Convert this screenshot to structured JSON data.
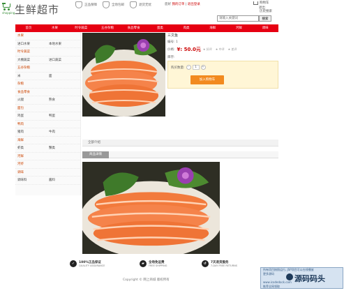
{
  "header": {
    "logo_cn": "生鲜超市",
    "logo_en": "shopping",
    "badges": [
      "正品保障",
      "全场包邮",
      "退货无忧"
    ],
    "welcome": "您好",
    "account_link": "我的订单",
    "separator": "|",
    "register": "退出登录",
    "cart": "购物车",
    "logout": "退出",
    "history": "历史搜索",
    "search_placeholder": "请输入关键词",
    "search_button": "搜索"
  },
  "nav": {
    "items": [
      "首页",
      "水果",
      "时令蔬菜",
      "五谷杂粮",
      "食品零食",
      "蛋类",
      "肉类",
      "海鲜",
      "河鲜",
      "调味"
    ]
  },
  "sidebar": {
    "rows": [
      [
        "水果",
        ""
      ],
      [
        "进口水果",
        "本地水果"
      ],
      [
        "时令蔬菜",
        ""
      ],
      [
        "大棚蔬菜",
        "进口蔬菜"
      ],
      [
        "五谷杂粮",
        ""
      ],
      [
        "米",
        "面"
      ],
      [
        "杂粮",
        ""
      ],
      [
        "食品零食",
        ""
      ],
      [
        "火腿",
        "熟食"
      ],
      [
        "面包",
        ""
      ],
      [
        "鸡蛋",
        "鸭蛋"
      ],
      [
        "鸭肉",
        ""
      ],
      [
        "猪肉",
        "牛肉"
      ],
      [
        "海鲜",
        ""
      ],
      [
        "虾类",
        "蟹类"
      ],
      [
        "河鲜",
        ""
      ],
      [
        "河虾",
        ""
      ],
      [
        "调味",
        ""
      ],
      [
        "调味料",
        "酱料"
      ]
    ]
  },
  "product": {
    "name": "三文鱼",
    "code_label": "编号:",
    "code_value": "1",
    "price_label": "价格:",
    "price": "¥: 50.0元",
    "stars": [
      "★ 好评",
      "★ 中评",
      "★ 差评"
    ],
    "stock_label": "库存:",
    "stock_value": "",
    "qty_label": "购买数量:",
    "qty_minus": "-",
    "qty_value": "1",
    "qty_plus": "+",
    "add_to_cart": "加入购物车"
  },
  "tabs": {
    "detail_bar": "全部介绍",
    "detail_tab": "商品详情"
  },
  "footer": {
    "guarantees": [
      {
        "icon": "quality-icon",
        "title": "100%正品保证",
        "sub": "QUALITY ASSURANCE"
      },
      {
        "icon": "shipping-icon",
        "title": "全场免运费",
        "sub": "FREE SHIPPING"
      },
      {
        "icon": "return-icon",
        "title": "7天退货服务",
        "sub": "7-DAY FREE RETURNS"
      }
    ],
    "copyright": "Copyright © 网上商城 版权所有"
  },
  "watermark": {
    "line1": "所有项目按照运行, JSP项目可以在线播放",
    "line2": "更多源码",
    "brand": "源码码头",
    "line3": "www.icodedock.com",
    "line4": "推荐全网领取"
  },
  "colors": {
    "nav_red": "#e60012",
    "price_red": "#cc0000",
    "cart_orange": "#f28a1f",
    "logo_green": "#3a8f3a"
  }
}
